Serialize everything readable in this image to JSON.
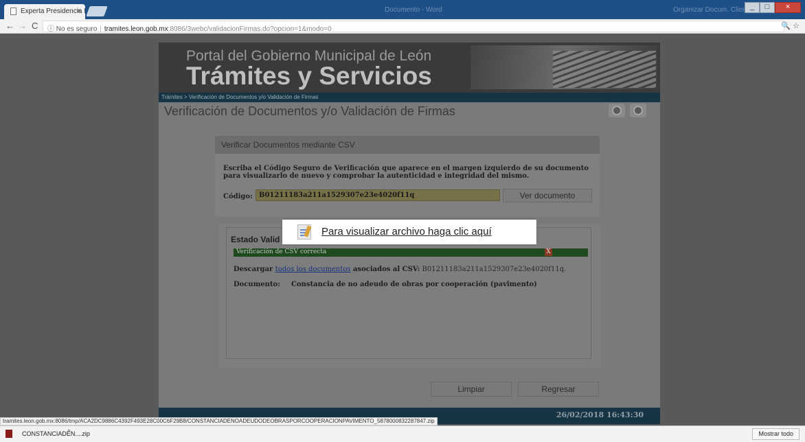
{
  "browser": {
    "tab_title": "Experta Presidencia Muni",
    "tab_close": "×",
    "window_title_center": "Documento - Word",
    "window_title_right": "Organizar Docum. Cliente",
    "win_minimize": "_",
    "win_maximize": "□",
    "win_close": "×",
    "nav_back": "←",
    "nav_forward": "→",
    "nav_reload": "C",
    "security_text": "ⓘ No es seguro",
    "url_host": "tramites.leon.gob.mx",
    "url_path": ":8086/3webc/validacionFirmas.do?opcion=1&modo=0",
    "toolbar_icons": "🔍 ☆"
  },
  "banner": {
    "line1": "Portal del Gobierno Municipal de León",
    "line2": "Trámites y Servicios"
  },
  "breadcrumb": "Trámites > Verificación de Documentos y/o Validación de Firmas",
  "page_title": "Verificación de Documentos y/o Validación de Firmas",
  "csv_section": {
    "header": "Verificar Documentos mediante CSV",
    "instructions": "Escriba el Código Seguro de Verificación que aparece en el margen izquierdo de su documento para visualizarlo de nuevo y comprobar la autenticidad e integridad del mismo.",
    "code_label": "Código:",
    "code_value": "B01211183a211a1529307e23e4020f11q",
    "view_button": "Ver documento"
  },
  "estado_section": {
    "title": "Estado Valid",
    "status_bar": "Verificación de CSV correcta",
    "status_close": "X",
    "download_prefix": "Descargar ",
    "download_link": "todos los documentos",
    "download_suffix": " asociados al CSV:",
    "download_csv": " B01211183a211a1529307e23e4020f11q.",
    "document_label": "Documento:",
    "document_value": "Constancia de no adeudo de obras por cooperación (pavimento)"
  },
  "popup": {
    "text": "Para visualizar archivo haga clic aquí"
  },
  "buttons": {
    "clear": "Limpiar",
    "back": "Regresar"
  },
  "footer": {
    "datetime": "26/02/2018 16:43:30"
  },
  "status_url": "tramites.leon.gob.mx:8086/tmp/ACA2DC9886C4392F493E28C00C6F29B8/CONSTANCIADENOADEUDODEOBRASPORCOOPERACIONPAVIMENTO_5878000832287847.zip",
  "download_shelf": {
    "file_name": "CONSTANCIADEN....zip",
    "caret": "^",
    "show_all": "Mostrar todo"
  }
}
